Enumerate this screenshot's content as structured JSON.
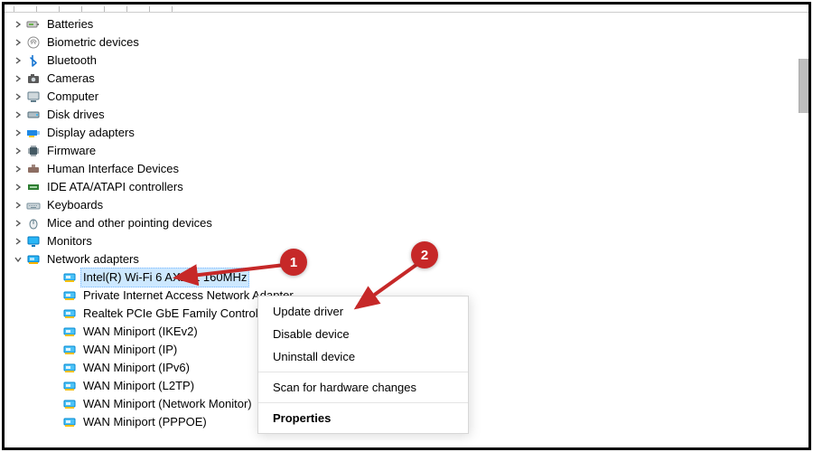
{
  "categories": [
    {
      "id": "batteries",
      "label": "Batteries",
      "icon": "battery-icon"
    },
    {
      "id": "biometric",
      "label": "Biometric devices",
      "icon": "fingerprint-icon"
    },
    {
      "id": "bluetooth",
      "label": "Bluetooth",
      "icon": "bluetooth-icon"
    },
    {
      "id": "cameras",
      "label": "Cameras",
      "icon": "camera-icon"
    },
    {
      "id": "computer",
      "label": "Computer",
      "icon": "computer-icon"
    },
    {
      "id": "disk-drives",
      "label": "Disk drives",
      "icon": "disk-icon"
    },
    {
      "id": "display-adapters",
      "label": "Display adapters",
      "icon": "display-adapter-icon"
    },
    {
      "id": "firmware",
      "label": "Firmware",
      "icon": "chip-icon"
    },
    {
      "id": "hid",
      "label": "Human Interface Devices",
      "icon": "hid-icon"
    },
    {
      "id": "ide",
      "label": "IDE ATA/ATAPI controllers",
      "icon": "ide-icon"
    },
    {
      "id": "keyboards",
      "label": "Keyboards",
      "icon": "keyboard-icon"
    },
    {
      "id": "mice",
      "label": "Mice and other pointing devices",
      "icon": "mouse-icon"
    },
    {
      "id": "monitors",
      "label": "Monitors",
      "icon": "monitor-icon"
    },
    {
      "id": "network-adapters",
      "label": "Network adapters",
      "icon": "network-adapter-icon",
      "expanded": true,
      "children": [
        {
          "id": "wifi-ax201",
          "label": "Intel(R) Wi-Fi 6 AX201 160MHz",
          "selected": true
        },
        {
          "id": "pia",
          "label": "Private Internet Access Network Adapter"
        },
        {
          "id": "realtek",
          "label": "Realtek PCIe GbE Family Controller"
        },
        {
          "id": "wan-ikev2",
          "label": "WAN Miniport (IKEv2)"
        },
        {
          "id": "wan-ip",
          "label": "WAN Miniport (IP)"
        },
        {
          "id": "wan-ipv6",
          "label": "WAN Miniport (IPv6)"
        },
        {
          "id": "wan-l2tp",
          "label": "WAN Miniport (L2TP)"
        },
        {
          "id": "wan-netmon",
          "label": "WAN Miniport (Network Monitor)"
        },
        {
          "id": "wan-pppoe",
          "label": "WAN Miniport (PPPOE)"
        }
      ]
    }
  ],
  "context_menu": {
    "items": [
      {
        "id": "update-driver",
        "label": "Update driver"
      },
      {
        "id": "disable-device",
        "label": "Disable device"
      },
      {
        "id": "uninstall-device",
        "label": "Uninstall device"
      }
    ],
    "items2": [
      {
        "id": "scan-hardware",
        "label": "Scan for hardware changes"
      }
    ],
    "items3": [
      {
        "id": "properties",
        "label": "Properties",
        "bold": true
      }
    ]
  },
  "annotations": {
    "badge1": "1",
    "badge2": "2"
  }
}
